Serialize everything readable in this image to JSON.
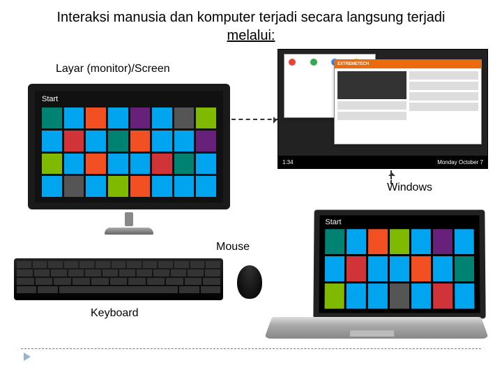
{
  "title_line1": "Interaksi manusia dan komputer terjadi secara langsung terjadi",
  "title_line2": "melalui:",
  "labels": {
    "screen": "Layar (monitor)/Screen",
    "windows": "Windows",
    "mouse": "Mouse",
    "keyboard": "Keyboard"
  },
  "win8_start_text": "Start",
  "browser_brand": "EXTREMETECH",
  "taskbar_time": "1:34",
  "taskbar_date": "Monday October 7"
}
